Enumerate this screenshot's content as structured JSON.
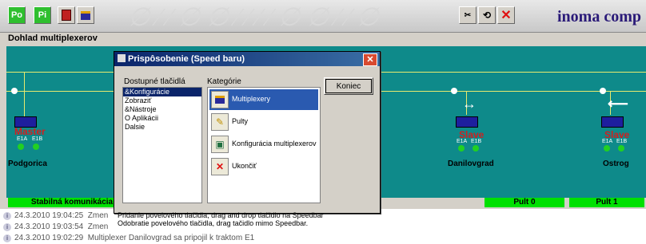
{
  "toolbar": {
    "left_buttons": [
      {
        "label": "Po",
        "icon": "po-icon",
        "color": "#33cc33"
      },
      {
        "label": "Pi",
        "icon": "pi-icon",
        "color": "#33cc33"
      },
      {
        "label": "",
        "icon": "tool-red-icon"
      },
      {
        "label": "",
        "icon": "multiplexer-icon"
      }
    ],
    "right_buttons": [
      {
        "icon": "speedbar-customize-icon"
      },
      {
        "icon": "undo-icon"
      },
      {
        "icon": "close-red-x-icon"
      }
    ],
    "brand": "inoma comp"
  },
  "main_title": "Dohlad multiplexerov",
  "diagram": {
    "nodes": [
      {
        "name": "Master",
        "ports": [
          "E1A",
          "E1B"
        ],
        "site": "Podgorica"
      },
      {
        "name": "Slave",
        "ports": [
          "E1A",
          "E1B"
        ],
        "site": "Danilovgrad"
      },
      {
        "name": "Slave",
        "ports": [
          "E1A",
          "E1B"
        ],
        "site": "Ostrog"
      }
    ],
    "status_bars": [
      {
        "label": "Stabilná komunikácia"
      },
      {
        "label": "Pult 0"
      },
      {
        "label": "Pult 1"
      }
    ]
  },
  "log": [
    {
      "time": "24.3.2010 19:04:25",
      "text": "Zmen"
    },
    {
      "time": "24.3.2010 19:03:54",
      "text": "Zmen"
    },
    {
      "time": "24.3.2010 19:02:29",
      "text": "Multiplexer Danilovgrad sa pripojil k traktom E1"
    }
  ],
  "dialog": {
    "title": "Prispôsobenie (Speed baru)",
    "available_label": "Dostupné tlačidlá",
    "category_label": "Kategórie",
    "available_items": [
      "&Konfigurácie",
      "Zobraziť",
      "&Nástroje",
      "O Aplikácii",
      "Dalsie"
    ],
    "selected_available_index": 0,
    "categories": [
      {
        "label": "Multiplexery",
        "icon": "multiplexer-icon",
        "selected": true
      },
      {
        "label": "Pulty",
        "icon": "console-icon",
        "selected": false
      },
      {
        "label": "Konfigurácia multiplexerov",
        "icon": "configuration-icon",
        "selected": false
      },
      {
        "label": "Ukončiť",
        "icon": "exit-x-icon",
        "selected": false
      }
    ],
    "close_button_label": "Koniec",
    "hint_line1": "Pridanie povelového tlačidla, drag and drop tlačidlo na Speedbar",
    "hint_line2": "Odobratie povelového tlačidla, drag tačidlo mimo Speedbar."
  },
  "colors": {
    "diagram_bg": "#0e8a8a",
    "status_green": "#00e000",
    "title_bar": "#0a246a",
    "selection": "#2a5ab0"
  }
}
